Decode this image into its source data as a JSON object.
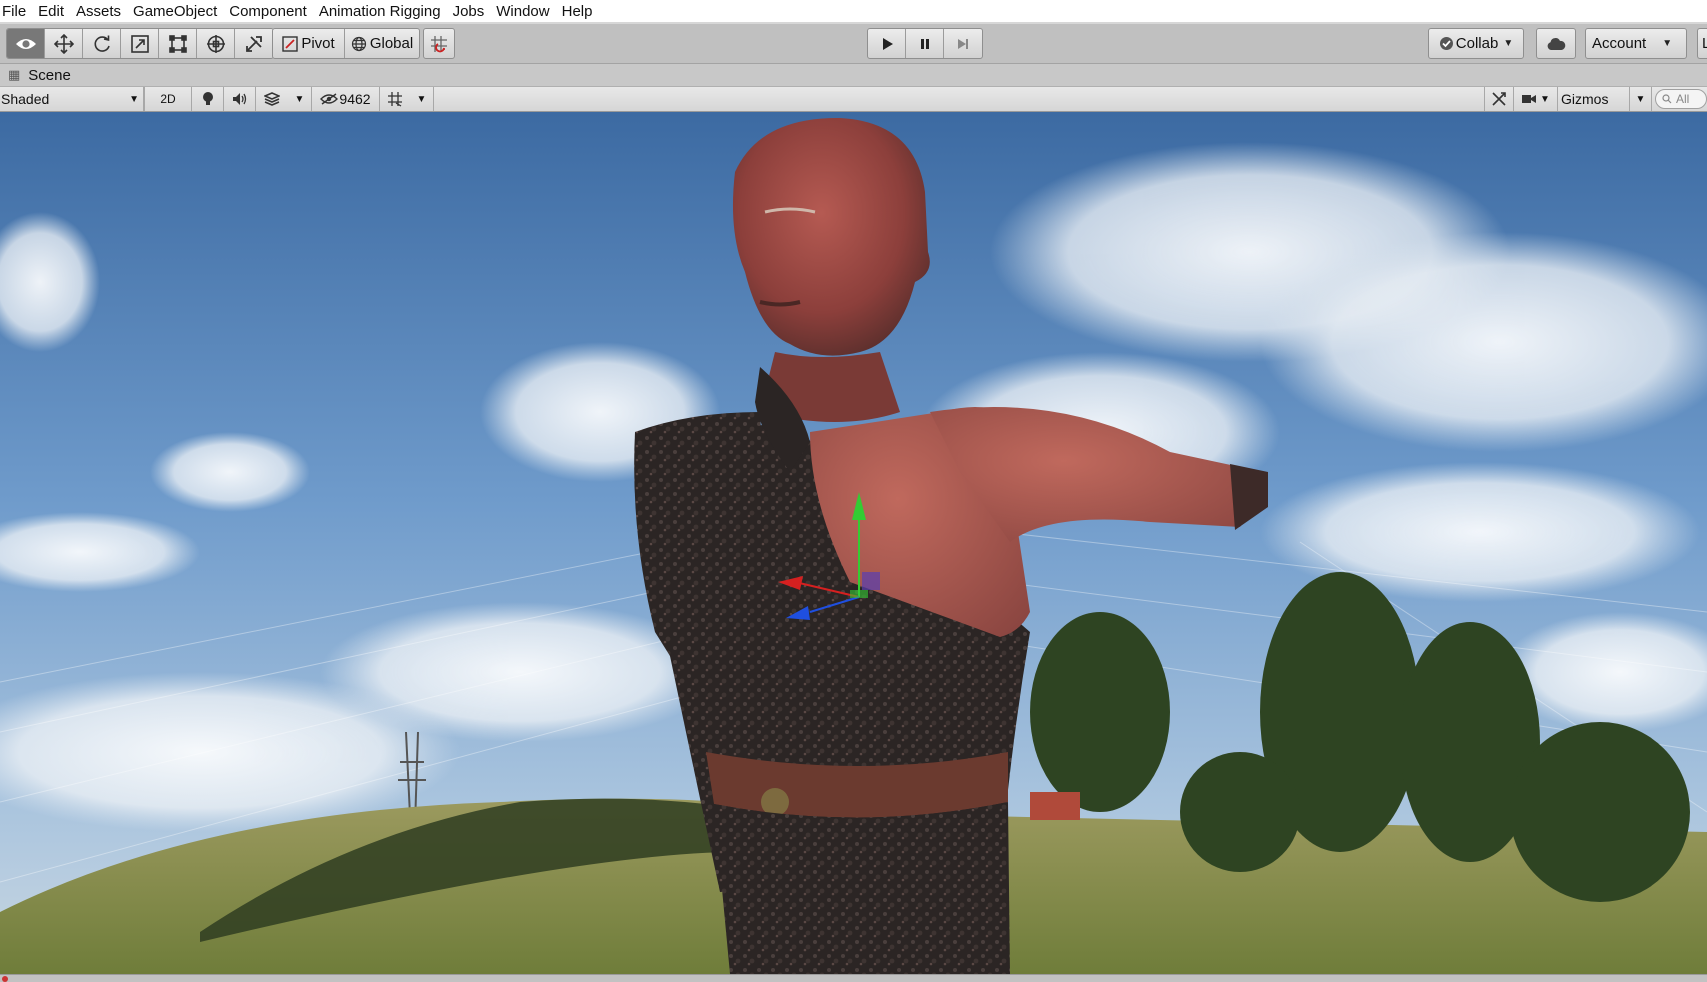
{
  "menu": [
    "File",
    "Edit",
    "Assets",
    "GameObject",
    "Component",
    "Animation Rigging",
    "Jobs",
    "Window",
    "Help"
  ],
  "toolbar": {
    "tools": [
      {
        "icon": "view-eye-icon",
        "selected": true
      },
      {
        "icon": "move-icon"
      },
      {
        "icon": "rotate-icon"
      },
      {
        "icon": "scale-icon"
      },
      {
        "icon": "rect-tool-icon"
      },
      {
        "icon": "transform-tool-icon"
      },
      {
        "icon": "custom-tool-icon"
      }
    ],
    "pivot_label": "Pivot",
    "global_label": "Global",
    "snap_icon": "grid-snap-icon",
    "play_icon": "play-icon",
    "pause_icon": "pause-icon",
    "step_icon": "step-icon",
    "collab_label": "Collab",
    "cloud_icon": "cloud-icon",
    "account_label": "Account",
    "layers_label": "L"
  },
  "scene_tab": {
    "title": "Scene"
  },
  "scene_bar": {
    "draw_mode": "Shaded",
    "mode_2d": "2D",
    "lighting_icon": "light-bulb-icon",
    "audio_icon": "audio-speaker-icon",
    "effects_icon": "effects-layers-icon",
    "hidden_count": "9462",
    "grid_icon": "grid-icon",
    "tools_icon": "tools-icon",
    "camera_icon": "camera-icon",
    "gizmos_label": "Gizmos",
    "search_placeholder": "All"
  },
  "colors": {
    "sky_top": "#3f6fa6",
    "sky_mid": "#7ea7d2",
    "skin": "#9a4a46",
    "vest": "#2a2524",
    "grass": "#a3a16a",
    "gizmo_y": "#33cc33",
    "gizmo_x": "#d62020",
    "gizmo_z": "#1f4fe0"
  }
}
